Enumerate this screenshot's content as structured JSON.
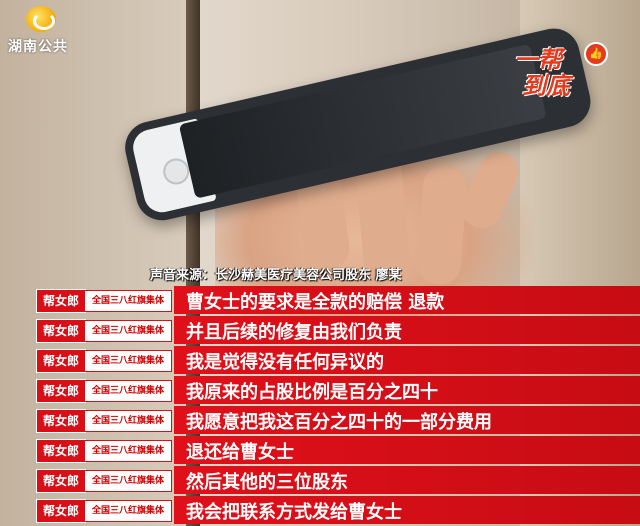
{
  "station_logo": {
    "text": "湖南公共",
    "icon": "hunan-tv-logo-icon"
  },
  "show_logo": {
    "line1": "一帮",
    "line2": "到底",
    "badge": "↗",
    "icon": "thumbs-up-icon"
  },
  "source_caption": "声音来源：长沙赫美医疗美容公司股东  廖某",
  "colors": {
    "subtitle_bar": "#d80f17",
    "logo_accent": "#e53a1c"
  },
  "subtitles": [
    {
      "tag": "帮女郎",
      "honor": "全国三八红旗集体",
      "text": "曹女士的要求是全款的赔偿  退款"
    },
    {
      "tag": "帮女郎",
      "honor": "全国三八红旗集体",
      "text": "并且后续的修复由我们负责"
    },
    {
      "tag": "帮女郎",
      "honor": "全国三八红旗集体",
      "text": "我是觉得没有任何异议的"
    },
    {
      "tag": "帮女郎",
      "honor": "全国三八红旗集体",
      "text": "我原来的占股比例是百分之四十"
    },
    {
      "tag": "帮女郎",
      "honor": "全国三八红旗集体",
      "text": "我愿意把我这百分之四十的一部分费用"
    },
    {
      "tag": "帮女郎",
      "honor": "全国三八红旗集体",
      "text": "退还给曹女士"
    },
    {
      "tag": "帮女郎",
      "honor": "全国三八红旗集体",
      "text": "然后其他的三位股东"
    },
    {
      "tag": "帮女郎",
      "honor": "全国三八红旗集体",
      "text": "我会把联系方式发给曹女士"
    }
  ]
}
